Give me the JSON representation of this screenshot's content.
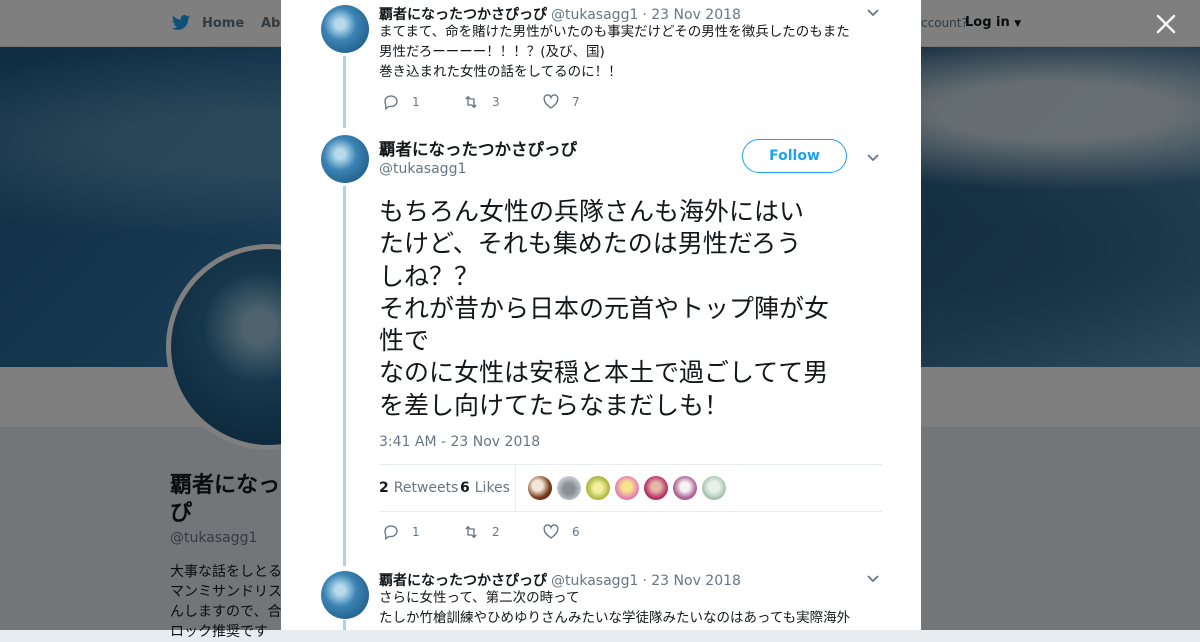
{
  "background": {
    "nav_home": "Home",
    "nav_about": "Abo",
    "have_account": "ccount?",
    "login": "Log in",
    "profile_name": "覇者になっ ぴ",
    "profile_name_line1": "覇者になっ",
    "profile_name_line2": "ぴ",
    "profile_handle": "@tukasagg1",
    "bio_lines": [
      "大事な話をしとる",
      "マンミサンドリス",
      "んしますので、合",
      "ロック推奨です"
    ]
  },
  "close_icon": "close-icon",
  "accent_color": "#1da1f2",
  "tweets": {
    "prev": {
      "name": "覇者になったつかさぴっぴ",
      "handle": "@tukasagg1",
      "date": "· 23 Nov 2018",
      "lines": [
        "まてまて、命を賭けた男性がいたのも事実だけどその男性を徴兵したのもまた",
        "男性だろーーーー！！！？(及び、国)",
        "巻き込まれた女性の話をしてるのに！！"
      ],
      "replies": "1",
      "retweets": "3",
      "likes": "7"
    },
    "main": {
      "name": "覇者になったつかさぴっぴ",
      "handle": "@tukasagg1",
      "follow_label": "Follow",
      "lines": [
        "もちろん女性の兵隊さんも海外にはい",
        "たけど、それも集めたのは男性だろう",
        "しね？？",
        "それが昔から日本の元首やトップ陣が女",
        "性で",
        "なのに女性は安穏と本土で過ごしてて男",
        "を差し向けてたらなまだしも！"
      ],
      "timestamp": "3:41 AM - 23 Nov 2018",
      "retweet_count": "2",
      "retweet_label": "Retweets",
      "like_count": "6",
      "like_label": "Likes",
      "replies": "1",
      "retweets": "2",
      "likes": "6"
    },
    "next": {
      "name": "覇者になったつかさぴっぴ",
      "handle": "@tukasagg1",
      "date": "· 23 Nov 2018",
      "lines": [
        "さらに女性って、第二次の時って",
        "たしか竹槍訓練やひめゆりさんみたいな学徒隊みたいなのはあっても実際海外"
      ]
    }
  }
}
